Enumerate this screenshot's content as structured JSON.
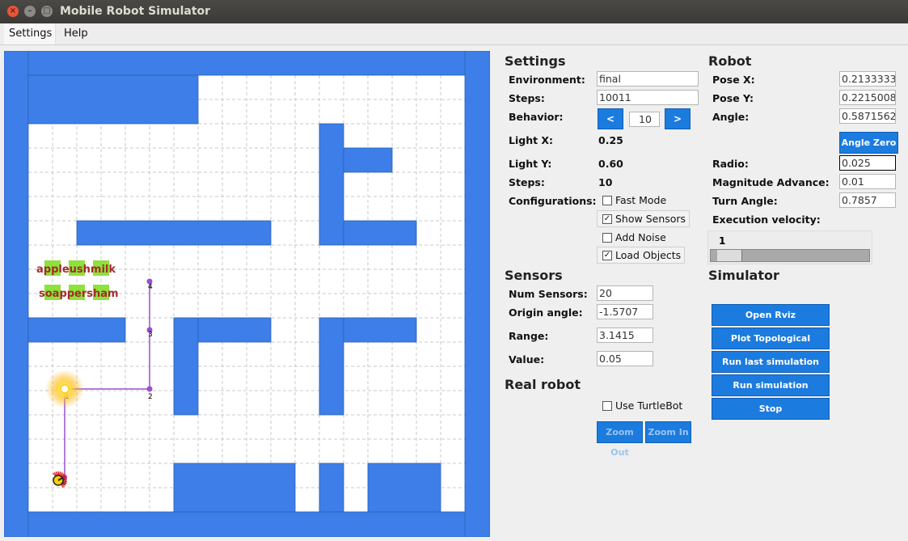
{
  "window": {
    "title": "Mobile Robot Simulator"
  },
  "menu": {
    "settings": "Settings",
    "help": "Help"
  },
  "settings": {
    "header": "Settings",
    "environment_label": "Environment:",
    "environment_value": "final",
    "steps_label": "Steps:",
    "steps_value": "10011",
    "behavior_label": "Behavior:",
    "behavior_prev": "<",
    "behavior_value": "10",
    "behavior_next": ">",
    "light_x_label": "Light X:",
    "light_x_value": "0.25",
    "light_y_label": "Light Y:",
    "light_y_value": "0.60",
    "steps2_label": "Steps:",
    "steps2_value": "10",
    "configurations_label": "Configurations:",
    "fast_mode": "Fast Mode",
    "fast_mode_checked": false,
    "show_sensors": "Show Sensors",
    "show_sensors_checked": true,
    "add_noise": "Add Noise",
    "add_noise_checked": false,
    "load_objects": "Load Objects",
    "load_objects_checked": true
  },
  "sensors": {
    "header": "Sensors",
    "num_sensors_label": "Num Sensors:",
    "num_sensors_value": "20",
    "origin_angle_label": "Origin angle:",
    "origin_angle_value": "-1.5707",
    "range_label": "Range:",
    "range_value": "3.1415",
    "value_label": "Value:",
    "value_value": "0.05"
  },
  "real_robot": {
    "header": "Real robot",
    "use_turtlebot": "Use TurtleBot",
    "use_turtlebot_checked": false,
    "zoom_out": "Zoom Out",
    "zoom_in": "Zoom In"
  },
  "robot": {
    "header": "Robot",
    "pose_x_label": "Pose X:",
    "pose_x_value": "0.2133333",
    "pose_y_label": "Pose Y:",
    "pose_y_value": "0.2215008",
    "angle_label": "Angle:",
    "angle_value": "0.5871562",
    "angle_zero": "Angle Zero",
    "radio_label": "Radio:",
    "radio_value": "0.025",
    "magnitude_label": "Magnitude Advance:",
    "magnitude_value": "0.01",
    "turn_angle_label": "Turn Angle:",
    "turn_angle_value": "0.7857",
    "execution_velocity_label": "Execution velocity:",
    "execution_velocity_value": "1",
    "velocity_fraction": 0.05
  },
  "simulator": {
    "header": "Simulator",
    "open_rviz": "Open Rviz",
    "plot_topological": "Plot Topological",
    "run_last_simulation": "Run last simulation",
    "run_simulation": "Run simulation",
    "stop": "Stop"
  },
  "map": {
    "objects_row1": "appleushmilk",
    "objects_row2": "soappersham",
    "nodes": [
      "1",
      "2",
      "3",
      "4"
    ],
    "robot_node_label": "0",
    "colors": {
      "wall": "#3d7ee8",
      "object": "#8de23c",
      "object_text": "#a52a2a",
      "path": "#9b4fd1",
      "background": "#ffffff"
    }
  }
}
